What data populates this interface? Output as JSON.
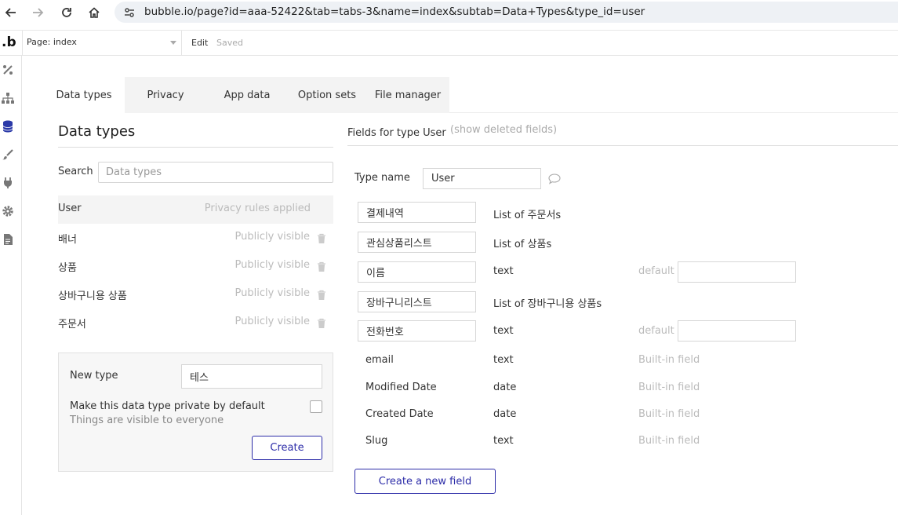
{
  "browser": {
    "url": "bubble.io/page?id=aaa-52422&tab=tabs-3&name=index&subtab=Data+Types&type_id=user"
  },
  "toolbar": {
    "logo": ".b",
    "page_label": "Page: index",
    "edit_label": "Edit",
    "saved_label": "Saved"
  },
  "tabs": [
    {
      "label": "Data types",
      "active": true
    },
    {
      "label": "Privacy",
      "active": false
    },
    {
      "label": "App data",
      "active": false
    },
    {
      "label": "Option sets",
      "active": false
    },
    {
      "label": "File manager",
      "active": false
    }
  ],
  "left_panel": {
    "title": "Data types",
    "search_label": "Search",
    "search_placeholder": "Data types",
    "types": [
      {
        "name": "User",
        "status": "Privacy rules applied",
        "selected": true
      },
      {
        "name": "배너",
        "status": "Publicly visible",
        "selected": false
      },
      {
        "name": "상품",
        "status": "Publicly visible",
        "selected": false
      },
      {
        "name": "상바구니용 상품",
        "status": "Publicly visible",
        "selected": false
      },
      {
        "name": "주문서",
        "status": "Publicly visible",
        "selected": false
      }
    ],
    "new_type": {
      "label": "New type",
      "value": "테스",
      "private_label": "Make this data type private by default",
      "visible_note": "Things are visible to everyone",
      "create_label": "Create"
    }
  },
  "right_panel": {
    "title": "Fields for type User",
    "show_deleted": "(show deleted fields)",
    "type_name_label": "Type name",
    "type_name_value": "User",
    "fields": [
      {
        "name": "결제내역",
        "type": "List of 주문서s"
      },
      {
        "name": "관심상품리스트",
        "type": "List of 상품s"
      },
      {
        "name": "이름",
        "type": "text",
        "default_label": "default"
      },
      {
        "name": "장바구니리스트",
        "type": "List of 장바구니용 상품s"
      },
      {
        "name": "전화번호",
        "type": "text",
        "default_label": "default"
      }
    ],
    "builtin_fields": [
      {
        "name": "email",
        "type": "text",
        "tag": "Built-in field"
      },
      {
        "name": "Modified Date",
        "type": "date",
        "tag": "Built-in field"
      },
      {
        "name": "Created Date",
        "type": "date",
        "tag": "Built-in field"
      },
      {
        "name": "Slug",
        "type": "text",
        "tag": "Built-in field"
      }
    ],
    "new_field_label": "Create a new field"
  }
}
